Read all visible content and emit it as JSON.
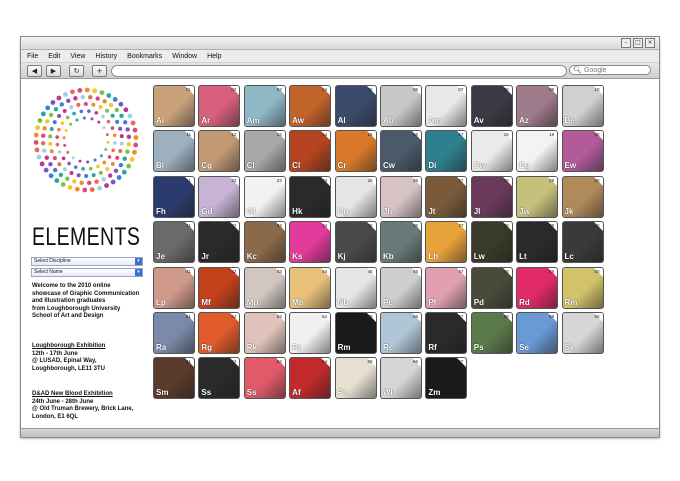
{
  "browser": {
    "menu": [
      "File",
      "Edit",
      "View",
      "History",
      "Bookmarks",
      "Window",
      "Help"
    ],
    "search_placeholder": "Google",
    "url": ""
  },
  "site": {
    "brand": "ELEMENTS",
    "select_discipline": "Select Discipline",
    "select_name": "Select Name",
    "intro": [
      "Welcome to the 2010 online",
      "showcase of Graphic Communication",
      "and Illustration graduates",
      "from Loughborough University",
      "School of Art and Design"
    ],
    "exhibit1_title": "Loughborough Exhibition",
    "exhibit1_lines": [
      "12th - 17th June",
      "@ LUSAD, Epinal Way,",
      "Loughborough, LE11 3TU"
    ],
    "exhibit2_title": "D&AD New Blood Exhibition",
    "exhibit2_lines": [
      "24th June - 28th June",
      "@ Old Truman Brewery, Brick Lane,",
      "London, E1 6QL"
    ]
  },
  "tiles": [
    {
      "n": "01",
      "s": "Ai",
      "c": "#c9a27a"
    },
    {
      "n": "02",
      "s": "Ar",
      "c": "#d9607c"
    },
    {
      "n": "03",
      "s": "Am",
      "c": "#8fb8c6"
    },
    {
      "n": "04",
      "s": "Aw",
      "c": "#c2632b"
    },
    {
      "n": "05",
      "s": "Al",
      "c": "#3c4a6b"
    },
    {
      "n": "06",
      "s": "Ab",
      "c": "#c8c8c8"
    },
    {
      "n": "07",
      "s": "Am",
      "c": "#e8e8e8"
    },
    {
      "n": "08",
      "s": "Av",
      "c": "#3a3a44"
    },
    {
      "n": "09",
      "s": "Az",
      "c": "#9e7a8a"
    },
    {
      "n": "10",
      "s": "Be",
      "c": "#d0d0d0"
    },
    {
      "n": "11",
      "s": "Bl",
      "c": "#9db0c0"
    },
    {
      "n": "12",
      "s": "Cg",
      "c": "#c19a74"
    },
    {
      "n": "13",
      "s": "Cl",
      "c": "#a8a8a8"
    },
    {
      "n": "14",
      "s": "Cl",
      "c": "#b3441f"
    },
    {
      "n": "15",
      "s": "Cr",
      "c": "#d87a2a"
    },
    {
      "n": "16",
      "s": "Cw",
      "c": "#4a5a6a"
    },
    {
      "n": "17",
      "s": "Di",
      "c": "#2f7f8f"
    },
    {
      "n": "18",
      "s": "Dw",
      "c": "#eaeaea"
    },
    {
      "n": "19",
      "s": "Eg",
      "c": "#f3f3f3"
    },
    {
      "n": "20",
      "s": "Ew",
      "c": "#b25a9a"
    },
    {
      "n": "21",
      "s": "Fh",
      "c": "#2b3b6e"
    },
    {
      "n": "22",
      "s": "Gd",
      "c": "#c6b3d6"
    },
    {
      "n": "23",
      "s": "Gf",
      "c": "#f2f2f2"
    },
    {
      "n": "24",
      "s": "Hk",
      "c": "#2a2a2a"
    },
    {
      "n": "25",
      "s": "Hg",
      "c": "#e5e5e5"
    },
    {
      "n": "26",
      "s": "Jh",
      "c": "#d7c2c6"
    },
    {
      "n": "27",
      "s": "Jt",
      "c": "#7a5a3a"
    },
    {
      "n": "28",
      "s": "Jl",
      "c": "#6a3a5a"
    },
    {
      "n": "29",
      "s": "Jw",
      "c": "#c7c07a"
    },
    {
      "n": "30",
      "s": "Jk",
      "c": "#b08a5a"
    },
    {
      "n": "31",
      "s": "Je",
      "c": "#6a6a6a"
    },
    {
      "n": "32",
      "s": "Jr",
      "c": "#2a2a2a"
    },
    {
      "n": "33",
      "s": "Kc",
      "c": "#8a6a4a"
    },
    {
      "n": "34",
      "s": "Ks",
      "c": "#e23a9a"
    },
    {
      "n": "35",
      "s": "Kj",
      "c": "#4a4a4a"
    },
    {
      "n": "36",
      "s": "Kb",
      "c": "#6a7a7a"
    },
    {
      "n": "37",
      "s": "Lh",
      "c": "#e8a23a"
    },
    {
      "n": "38",
      "s": "Lw",
      "c": "#3a3a2a"
    },
    {
      "n": "39",
      "s": "Lt",
      "c": "#2a2a2a"
    },
    {
      "n": "40",
      "s": "Lc",
      "c": "#3a3a3a"
    },
    {
      "n": "41",
      "s": "Lp",
      "c": "#d09a8a"
    },
    {
      "n": "42",
      "s": "Mf",
      "c": "#c2401a"
    },
    {
      "n": "43",
      "s": "Mp",
      "c": "#d2c7c0"
    },
    {
      "n": "44",
      "s": "Mb",
      "c": "#e7c07a"
    },
    {
      "n": "45",
      "s": "Nb",
      "c": "#e6e6e6"
    },
    {
      "n": "46",
      "s": "Pc",
      "c": "#cfcfcf"
    },
    {
      "n": "47",
      "s": "Pf",
      "c": "#e0a0b0"
    },
    {
      "n": "48",
      "s": "Pd",
      "c": "#4a4a3a"
    },
    {
      "n": "49",
      "s": "Rd",
      "c": "#e02a6a"
    },
    {
      "n": "50",
      "s": "Rm",
      "c": "#d2c26a"
    },
    {
      "n": "51",
      "s": "Ra",
      "c": "#7a8aa8"
    },
    {
      "n": "52",
      "s": "Rg",
      "c": "#e05a2a"
    },
    {
      "n": "53",
      "s": "Rk",
      "c": "#e0c2ba"
    },
    {
      "n": "54",
      "s": "Rt",
      "c": "#f0f0f0"
    },
    {
      "n": "55",
      "s": "Rm",
      "c": "#1a1a1a"
    },
    {
      "n": "56",
      "s": "Rc",
      "c": "#b0c6d6"
    },
    {
      "n": "57",
      "s": "Rf",
      "c": "#2a2a2a"
    },
    {
      "n": "58",
      "s": "Ps",
      "c": "#5a7a4a"
    },
    {
      "n": "59",
      "s": "Se",
      "c": "#6a9ad6"
    },
    {
      "n": "60",
      "s": "Sk",
      "c": "#d6d6d6"
    },
    {
      "n": "61",
      "s": "Sm",
      "c": "#5a3a2a"
    },
    {
      "n": "62",
      "s": "Ss",
      "c": "#2a2a2a"
    },
    {
      "n": "63",
      "s": "Ss",
      "c": "#e05a6a"
    },
    {
      "n": "64",
      "s": "Af",
      "c": "#c02a2a"
    },
    {
      "n": "65",
      "s": "Pn",
      "c": "#e6e0d0"
    },
    {
      "n": "66",
      "s": "Wl",
      "c": "#d6d6d6"
    },
    {
      "n": "67",
      "s": "Zm",
      "c": "#1a1a1a"
    }
  ]
}
